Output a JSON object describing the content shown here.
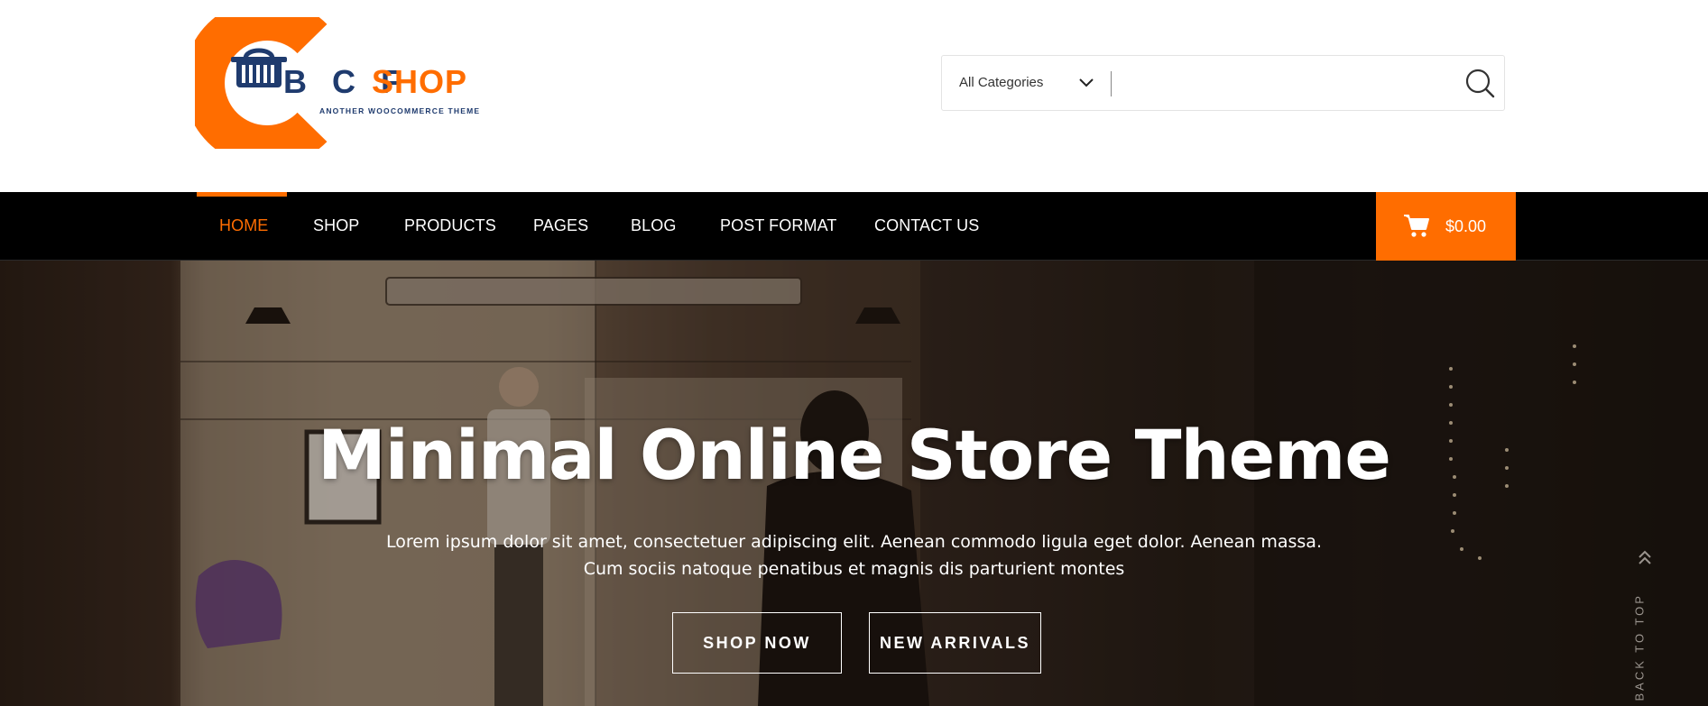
{
  "logo": {
    "brand_letters": "B C F",
    "brand_shop": "SHOP",
    "tagline": "ANOTHER WOOCOMMERCE THEME",
    "icon": "shopping-basket-icon"
  },
  "search": {
    "category_selected": "All Categories",
    "placeholder": "",
    "value": "",
    "chevron_icon": "chevron-down-icon",
    "button_icon": "search-icon"
  },
  "nav": {
    "items": [
      {
        "label": "HOME",
        "active": true
      },
      {
        "label": "SHOP",
        "active": false
      },
      {
        "label": "PRODUCTS",
        "active": false
      },
      {
        "label": "PAGES",
        "active": false
      },
      {
        "label": "BLOG",
        "active": false
      },
      {
        "label": "POST FORMAT",
        "active": false
      },
      {
        "label": "CONTACT US",
        "active": false
      }
    ],
    "cart": {
      "total": "$0.00",
      "icon": "cart-icon"
    }
  },
  "hero": {
    "title": "Minimal Online Store Theme",
    "subtitle_line1": "Lorem ipsum dolor sit amet, consectetuer adipiscing elit. Aenean commodo ligula eget dolor. Aenean massa.",
    "subtitle_line2": "Cum sociis natoque penatibus et magnis dis parturient montes",
    "buttons": {
      "primary": "SHOP NOW",
      "secondary": "NEW ARRIVALS"
    },
    "back_to_top": "BACK TO TOP"
  },
  "colors": {
    "accent": "#ff6d00",
    "brand_navy": "#1f3b6e",
    "nav_background": "#000000",
    "nav_text": "#ffffff"
  }
}
